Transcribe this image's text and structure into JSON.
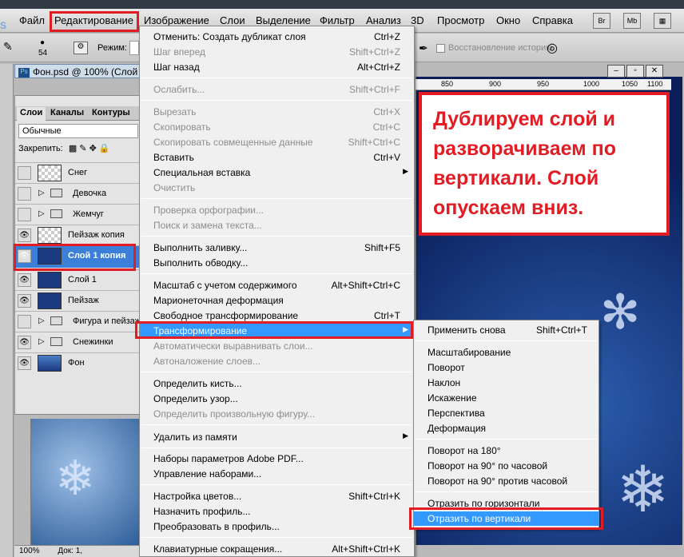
{
  "menubar": {
    "items": [
      "Файл",
      "Редактирование",
      "Изображение",
      "Слои",
      "Выделение",
      "Фильтр",
      "Анализ",
      "3D",
      "Просмотр",
      "Окно",
      "Справка"
    ],
    "right_buttons": [
      "Br",
      "Mb"
    ]
  },
  "options_bar": {
    "brush_size": "54",
    "mode_label": "Режим:",
    "restore_history_label": "Восстановление историю"
  },
  "document": {
    "tab_title": "Фон.psd @ 100% (Слой",
    "zoom": "100%",
    "doc_label": "Док: 1,",
    "ruler_marks": [
      "850",
      "900",
      "950",
      "1000",
      "1050",
      "1100"
    ]
  },
  "layers_panel": {
    "tabs": [
      "Слои",
      "Каналы",
      "Контуры"
    ],
    "blend_mode": "Обычные",
    "lock_label": "Закрепить:",
    "layers": [
      {
        "name": "Снег",
        "visible": false,
        "type": "layer"
      },
      {
        "name": "Девочка",
        "visible": false,
        "type": "group"
      },
      {
        "name": "Жемчуг",
        "visible": false,
        "type": "group"
      },
      {
        "name": "Пейзаж копия",
        "visible": true,
        "type": "layer"
      },
      {
        "name": "Слой 1 копия",
        "visible": true,
        "type": "layer",
        "selected": true
      },
      {
        "name": "Слой 1",
        "visible": true,
        "type": "layer"
      },
      {
        "name": "Пейзаж",
        "visible": true,
        "type": "layer"
      },
      {
        "name": "Фигура и пейзаж",
        "visible": false,
        "type": "group"
      },
      {
        "name": "Снежинки",
        "visible": true,
        "type": "group"
      },
      {
        "name": "Фон",
        "visible": true,
        "type": "layer"
      }
    ]
  },
  "edit_menu": {
    "items": [
      {
        "label": "Отменить: Создать дубликат слоя",
        "shortcut": "Ctrl+Z",
        "disabled": false
      },
      {
        "label": "Шаг вперед",
        "shortcut": "Shift+Ctrl+Z",
        "disabled": true
      },
      {
        "label": "Шаг назад",
        "shortcut": "Alt+Ctrl+Z",
        "disabled": false
      },
      {
        "label": "Ослабить...",
        "shortcut": "Shift+Ctrl+F",
        "disabled": true
      },
      {
        "label": "Вырезать",
        "shortcut": "Ctrl+X",
        "disabled": true
      },
      {
        "label": "Скопировать",
        "shortcut": "Ctrl+C",
        "disabled": true
      },
      {
        "label": "Скопировать совмещенные данные",
        "shortcut": "Shift+Ctrl+C",
        "disabled": true
      },
      {
        "label": "Вставить",
        "shortcut": "Ctrl+V",
        "disabled": false
      },
      {
        "label": "Специальная вставка",
        "shortcut": "",
        "disabled": false,
        "submenu": true
      },
      {
        "label": "Очистить",
        "shortcut": "",
        "disabled": true
      },
      {
        "label": "Проверка орфографии...",
        "shortcut": "",
        "disabled": true
      },
      {
        "label": "Поиск и замена текста...",
        "shortcut": "",
        "disabled": true
      },
      {
        "label": "Выполнить заливку...",
        "shortcut": "Shift+F5",
        "disabled": false
      },
      {
        "label": "Выполнить обводку...",
        "shortcut": "",
        "disabled": false
      },
      {
        "label": "Масштаб с учетом содержимого",
        "shortcut": "Alt+Shift+Ctrl+C",
        "disabled": false
      },
      {
        "label": "Марионеточная деформация",
        "shortcut": "",
        "disabled": false
      },
      {
        "label": "Свободное трансформирование",
        "shortcut": "Ctrl+T",
        "disabled": false
      },
      {
        "label": "Трансформирование",
        "shortcut": "",
        "disabled": false,
        "submenu": true,
        "highlighted": true
      },
      {
        "label": "Автоматически выравнивать слои...",
        "shortcut": "",
        "disabled": true
      },
      {
        "label": "Автоналожение слоев...",
        "shortcut": "",
        "disabled": true
      },
      {
        "label": "Определить кисть...",
        "shortcut": "",
        "disabled": false
      },
      {
        "label": "Определить узор...",
        "shortcut": "",
        "disabled": false
      },
      {
        "label": "Определить произвольную фигуру...",
        "shortcut": "",
        "disabled": true
      },
      {
        "label": "Удалить из памяти",
        "shortcut": "",
        "disabled": false,
        "submenu": true
      },
      {
        "label": "Наборы параметров Adobe PDF...",
        "shortcut": "",
        "disabled": false
      },
      {
        "label": "Управление наборами...",
        "shortcut": "",
        "disabled": false
      },
      {
        "label": "Настройка цветов...",
        "shortcut": "Shift+Ctrl+K",
        "disabled": false
      },
      {
        "label": "Назначить профиль...",
        "shortcut": "",
        "disabled": false
      },
      {
        "label": "Преобразовать в профиль...",
        "shortcut": "",
        "disabled": false
      },
      {
        "label": "Клавиатурные сокращения...",
        "shortcut": "Alt+Shift+Ctrl+K",
        "disabled": false
      }
    ]
  },
  "transform_submenu": {
    "items": [
      {
        "label": "Применить снова",
        "shortcut": "Shift+Ctrl+T"
      },
      {
        "label": "Масштабирование",
        "shortcut": ""
      },
      {
        "label": "Поворот",
        "shortcut": ""
      },
      {
        "label": "Наклон",
        "shortcut": ""
      },
      {
        "label": "Искажение",
        "shortcut": ""
      },
      {
        "label": "Перспектива",
        "shortcut": ""
      },
      {
        "label": "Деформация",
        "shortcut": ""
      },
      {
        "label": "Поворот на 180°",
        "shortcut": ""
      },
      {
        "label": "Поворот на 90° по часовой",
        "shortcut": ""
      },
      {
        "label": "Поворот на 90° против часовой",
        "shortcut": ""
      },
      {
        "label": "Отразить по горизонтали",
        "shortcut": ""
      },
      {
        "label": "Отразить по вертикали",
        "shortcut": "",
        "highlighted": true
      }
    ]
  },
  "callout": {
    "text": "Дублируем слой и разворачиваем по вертикали. Слой опускаем вниз."
  },
  "colors": {
    "annotation_red": "#e31b23",
    "menu_highlight": "#3399ff",
    "selected_layer": "#3b7fd8"
  }
}
